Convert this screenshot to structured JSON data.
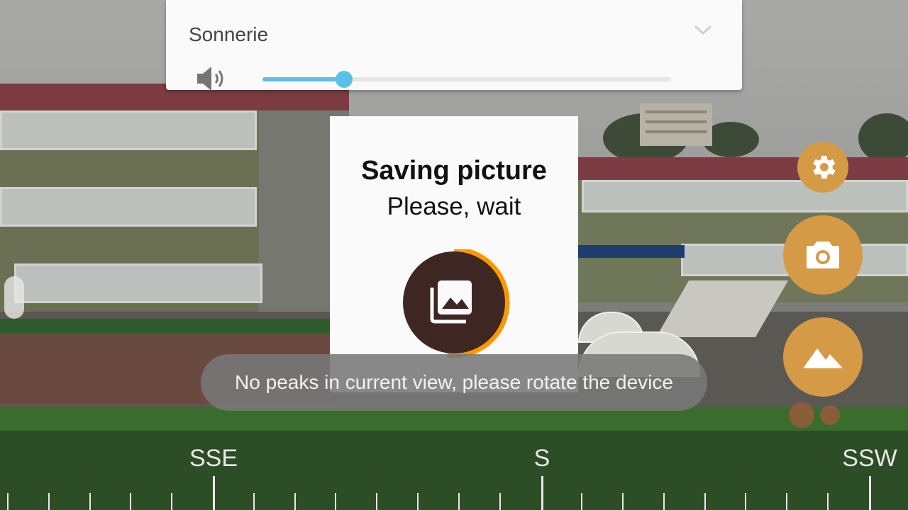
{
  "volume_panel": {
    "title": "Sonnerie",
    "level_percent": 20
  },
  "dialog": {
    "title": "Saving picture",
    "subtitle": "Please, wait",
    "progress_percent": 52
  },
  "toast": {
    "message": "No peaks in current view, please rotate the device"
  },
  "buttons": {
    "settings_icon": "gear-icon",
    "camera_icon": "camera-icon",
    "mountain_icon": "mountain-icon",
    "accent_color": "#d49a46"
  },
  "compass": {
    "labels": [
      "SSE",
      "S",
      "SSW"
    ]
  },
  "colors": {
    "slider": "#5bc1e4",
    "progress_ring": "#ff9800",
    "progress_center": "#3e2723"
  }
}
